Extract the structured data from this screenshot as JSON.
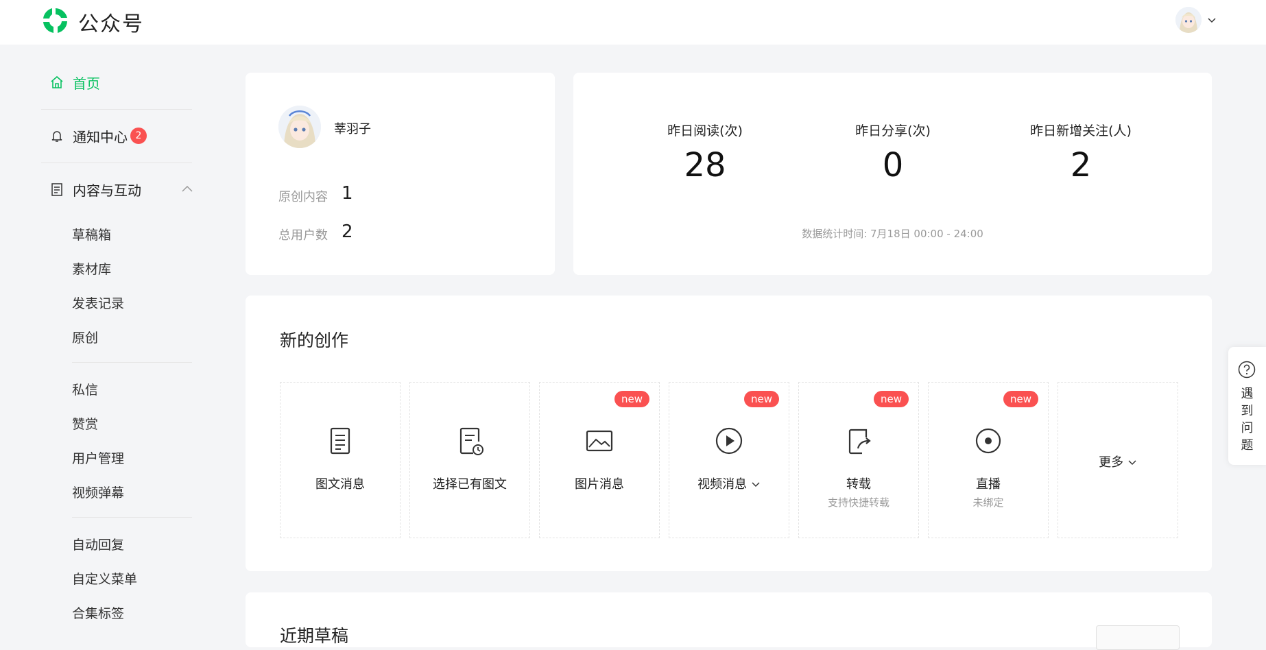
{
  "header": {
    "app_title": "公众号",
    "logo_icon": "wechat-mp-logo-icon",
    "accent": "#07c160"
  },
  "sidebar": {
    "home": "首页",
    "notify": "通知中心",
    "notify_count": "2",
    "content": "内容与互动",
    "group1": [
      "草稿箱",
      "素材库",
      "发表记录",
      "原创"
    ],
    "group2": [
      "私信",
      "赞赏",
      "用户管理",
      "视频弹幕"
    ],
    "group3": [
      "自动回复",
      "自定义菜单",
      "合集标签"
    ]
  },
  "profile": {
    "name": "莘羽子",
    "original_label": "原创内容",
    "original_value": "1",
    "users_label": "总用户数",
    "users_value": "2"
  },
  "stats": {
    "reads_label": "昨日阅读(次)",
    "reads_value": "28",
    "shares_label": "昨日分享(次)",
    "shares_value": "0",
    "follows_label": "昨日新增关注(人)",
    "follows_value": "2",
    "time_note": "数据统计时间: 7月18日 00:00 - 24:00"
  },
  "create": {
    "title": "新的创作",
    "new_tag": "new",
    "items": [
      {
        "label": "图文消息",
        "icon": "article-icon"
      },
      {
        "label": "选择已有图文",
        "icon": "existing-article-icon"
      },
      {
        "label": "图片消息",
        "icon": "image-icon"
      },
      {
        "label": "视频消息",
        "icon": "play-icon"
      },
      {
        "label": "转载",
        "sub": "支持快捷转载",
        "icon": "repost-icon"
      },
      {
        "label": "直播",
        "sub": "未绑定",
        "icon": "live-icon"
      }
    ],
    "more": "更多"
  },
  "drafts": {
    "title": "近期草稿"
  },
  "help": {
    "chars": [
      "遇",
      "到",
      "问",
      "题"
    ]
  },
  "colors": {
    "badge": "#fa5151",
    "page_bg": "#f4f5f7"
  }
}
